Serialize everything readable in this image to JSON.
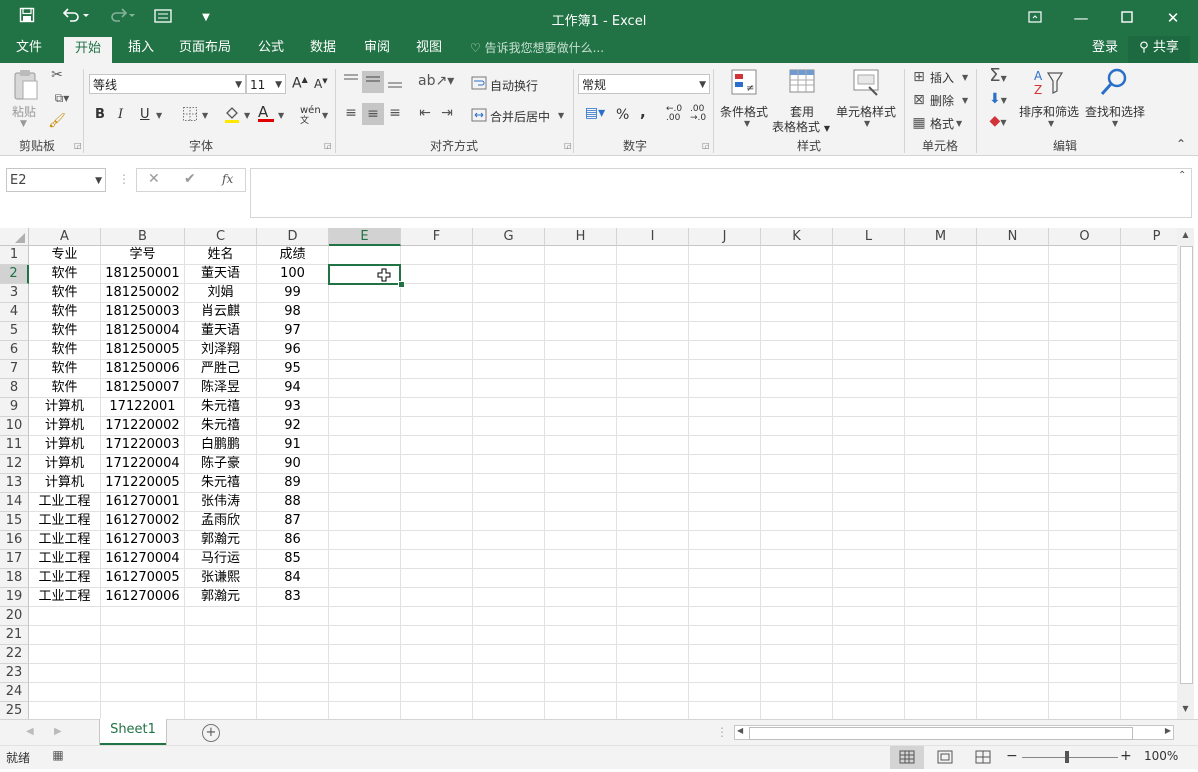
{
  "app": {
    "title": "工作簿1 - Excel",
    "accent": "#217346"
  },
  "qat": {
    "save_icon": "save-icon",
    "undo_icon": "undo-icon",
    "redo_icon": "redo-icon",
    "form_icon": "form-icon",
    "customize_icon": "customize-icon"
  },
  "tabs": [
    "文件",
    "开始",
    "插入",
    "页面布局",
    "公式",
    "数据",
    "审阅",
    "视图"
  ],
  "active_tab": "开始",
  "tellme": "告诉我您想要做什么...",
  "account": {
    "login": "登录",
    "share": "共享"
  },
  "ribbon": {
    "clipboard": {
      "label": "剪贴板",
      "paste": "粘贴"
    },
    "font": {
      "label": "字体",
      "font_name": "等线",
      "font_size": "11",
      "bold": "B",
      "italic": "I",
      "underline": "U",
      "grow": "A",
      "shrink": "A",
      "font_color_letter": "A",
      "phonetic": "wén"
    },
    "alignment": {
      "label": "对齐方式",
      "wrap": "自动换行",
      "merge": "合并后居中"
    },
    "number": {
      "label": "数字",
      "format": "常规",
      "percent": "%",
      "comma": ",",
      "inc_decimal": "←.0\n.00",
      "dec_decimal": ".00\n→.0"
    },
    "styles": {
      "label": "样式",
      "conditional": "条件格式",
      "table_1": "套用",
      "table_2": "表格格式",
      "cell_styles": "单元格样式"
    },
    "cells": {
      "label": "单元格",
      "insert": "插入",
      "delete": "删除",
      "format": "格式"
    },
    "editing": {
      "label": "编辑",
      "sort_filter": "排序和筛选",
      "find_select": "查找和选择"
    }
  },
  "formula_bar": {
    "name_box": "E2",
    "fx": "fx",
    "content": ""
  },
  "sheet": {
    "columns": [
      "A",
      "B",
      "C",
      "D",
      "E",
      "F",
      "G",
      "H",
      "I",
      "J",
      "K",
      "L",
      "M",
      "N",
      "O",
      "P"
    ],
    "selected_column": "E",
    "selected_row": "2",
    "row_numbers": [
      "1",
      "2",
      "3",
      "4",
      "5",
      "6",
      "7",
      "8",
      "9",
      "10",
      "11",
      "12",
      "13",
      "14",
      "15",
      "16",
      "17",
      "18",
      "19",
      "20",
      "21",
      "22",
      "23",
      "24",
      "25"
    ],
    "rows": [
      [
        "专业",
        "学号",
        "姓名",
        "成绩"
      ],
      [
        "软件",
        "181250001",
        "董天语",
        "100"
      ],
      [
        "软件",
        "181250002",
        "刘娟",
        "99"
      ],
      [
        "软件",
        "181250003",
        "肖云麒",
        "98"
      ],
      [
        "软件",
        "181250004",
        "董天语",
        "97"
      ],
      [
        "软件",
        "181250005",
        "刘泽翔",
        "96"
      ],
      [
        "软件",
        "181250006",
        "严胜己",
        "95"
      ],
      [
        "软件",
        "181250007",
        "陈泽昱",
        "94"
      ],
      [
        "计算机",
        "17122001",
        "朱元禧",
        "93"
      ],
      [
        "计算机",
        "171220002",
        "朱元禧",
        "92"
      ],
      [
        "计算机",
        "171220003",
        "白鹏鹏",
        "91"
      ],
      [
        "计算机",
        "171220004",
        "陈子豪",
        "90"
      ],
      [
        "计算机",
        "171220005",
        "朱元禧",
        "89"
      ],
      [
        "工业工程",
        "161270001",
        "张伟涛",
        "88"
      ],
      [
        "工业工程",
        "161270002",
        "孟雨欣",
        "87"
      ],
      [
        "工业工程",
        "161270003",
        "郭瀚元",
        "86"
      ],
      [
        "工业工程",
        "161270004",
        "马行运",
        "85"
      ],
      [
        "工业工程",
        "161270005",
        "张谦熙",
        "84"
      ],
      [
        "工业工程",
        "161270006",
        "郭瀚元",
        "83"
      ]
    ]
  },
  "sheet_tabs": {
    "active": "Sheet1"
  },
  "status": {
    "ready": "就绪",
    "zoom": "100%"
  }
}
